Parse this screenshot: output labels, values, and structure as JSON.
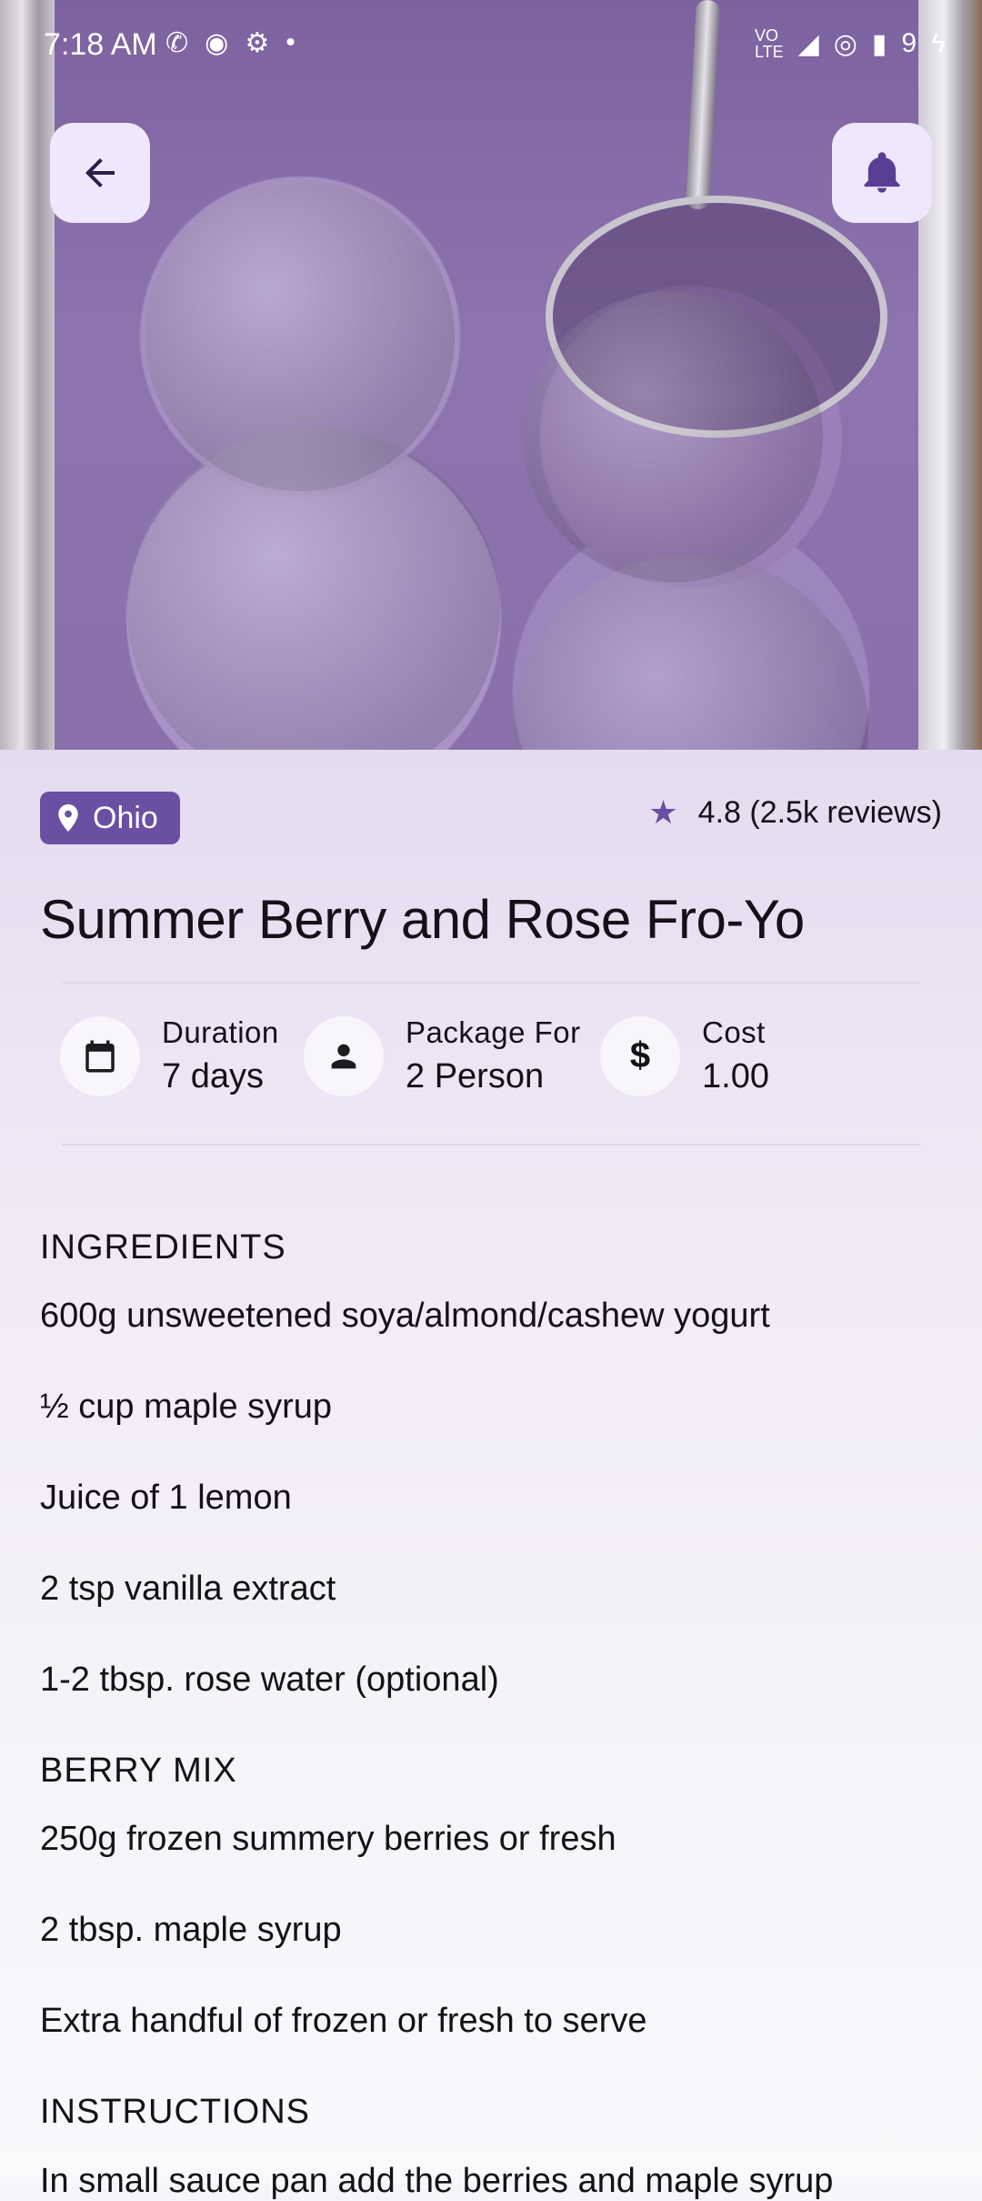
{
  "status_bar": {
    "time": "7:18 AM",
    "battery": "9"
  },
  "hero": {
    "back_label": "Back",
    "bell_label": "Notifications"
  },
  "location": "Ohio",
  "rating": "4.8 (2.5k reviews)",
  "title": "Summer Berry and Rose Fro-Yo",
  "stats": [
    {
      "label": "Duration",
      "value": "7 days",
      "icon": "calendar-icon"
    },
    {
      "label": "Package For",
      "value": "2 Person",
      "icon": "person-icon"
    },
    {
      "label": "Cost",
      "value": "1.00",
      "icon": "dollar-icon"
    }
  ],
  "sections": {
    "ingredients_heading": "INGREDIENTS",
    "ingredients": [
      "600g unsweetened soya/almond/cashew yogurt",
      "½ cup maple syrup",
      "Juice of 1 lemon",
      "2 tsp vanilla extract",
      "1-2 tbsp. rose water (optional)"
    ],
    "berry_heading": "BERRY MIX",
    "berry": [
      "250g frozen summery berries or fresh",
      "2 tbsp. maple syrup",
      "Extra handful of frozen or fresh to serve"
    ],
    "instructions_heading": "INSTRUCTIONS",
    "instructions_first": "In small sauce pan add the berries and maple syrup"
  },
  "colors": {
    "accent": "#6a4fa3",
    "icon_button_bg": "#efe7fb"
  }
}
